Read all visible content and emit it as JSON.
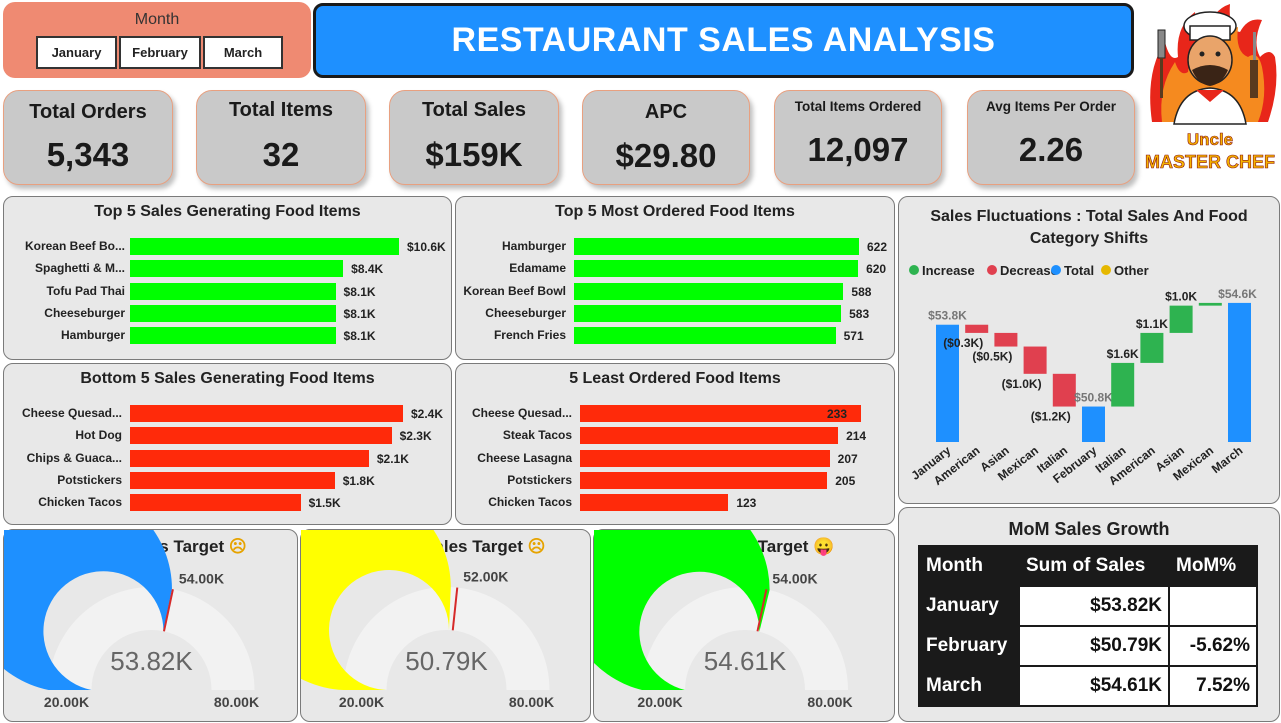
{
  "header": {
    "title": "RESTAURANT SALES ANALYSIS",
    "slicer_title": "Month",
    "months": [
      "January",
      "February",
      "March"
    ]
  },
  "logo": {
    "line1": "Uncle",
    "line2": "MASTER CHEF"
  },
  "kpis": [
    {
      "label": "Total Orders",
      "value": "5,343"
    },
    {
      "label": "Total Items",
      "value": "32"
    },
    {
      "label": "Total Sales",
      "value": "$159K"
    },
    {
      "label": "APC",
      "value": "$29.80"
    },
    {
      "label": "Total Items Ordered",
      "value": "12,097"
    },
    {
      "label": "Avg Items Per Order",
      "value": "2.26"
    }
  ],
  "colors": {
    "green": "#00ff00",
    "red": "#ff2a0a",
    "blue": "#1e90ff",
    "yellow": "#ffff00",
    "dec": "#e0404f",
    "inc": "#2eb350",
    "other": "#e6b800"
  },
  "chart_data": [
    {
      "type": "bar",
      "title": "Top 5 Sales Generating Food Items",
      "categories": [
        "Korean Beef Bo...",
        "Spaghetti & M...",
        "Tofu Pad Thai",
        "Cheeseburger",
        "Hamburger"
      ],
      "values": [
        10.6,
        8.4,
        8.1,
        8.1,
        8.1
      ],
      "labels": [
        "$10.6K",
        "$8.4K",
        "$8.1K",
        "$8.1K",
        "$8.1K"
      ]
    },
    {
      "type": "bar",
      "title": "Top 5 Most Ordered Food Items",
      "categories": [
        "Hamburger",
        "Edamame",
        "Korean Beef Bowl",
        "Cheeseburger",
        "French Fries"
      ],
      "values": [
        622,
        620,
        588,
        583,
        571
      ],
      "labels": [
        "622",
        "620",
        "588",
        "583",
        "571"
      ]
    },
    {
      "type": "bar",
      "title": "Bottom 5 Sales Generating Food Items",
      "categories": [
        "Cheese Quesad...",
        "Hot Dog",
        "Chips & Guaca...",
        "Potstickers",
        "Chicken Tacos"
      ],
      "values": [
        2.4,
        2.3,
        2.1,
        1.8,
        1.5
      ],
      "labels": [
        "$2.4K",
        "$2.3K",
        "$2.1K",
        "$1.8K",
        "$1.5K"
      ]
    },
    {
      "type": "bar",
      "title": "5 Least Ordered Food Items",
      "categories": [
        "Cheese Quesad...",
        "Steak Tacos",
        "Cheese Lasagna",
        "Potstickers",
        "Chicken Tacos"
      ],
      "values": [
        233,
        214,
        207,
        205,
        123
      ],
      "labels": [
        "233",
        "214",
        "207",
        "205",
        "123"
      ]
    },
    {
      "type": "waterfall",
      "title": "Sales Fluctuations : Total Sales And Food Category Shifts",
      "legend": [
        "Increase",
        "Decrease",
        "Total",
        "Other"
      ],
      "categories": [
        "January",
        "American",
        "Asian",
        "Mexican",
        "Italian",
        "February",
        "Italian",
        "American",
        "Asian",
        "Mexican",
        "March"
      ],
      "kinds": [
        "total",
        "dec",
        "dec",
        "dec",
        "dec",
        "total",
        "inc",
        "inc",
        "inc",
        "inc",
        "total"
      ],
      "values": [
        53.8,
        -0.3,
        -0.5,
        -1.0,
        -1.2,
        50.8,
        1.6,
        1.1,
        1.0,
        0.1,
        54.6
      ],
      "labels": [
        "$53.8K",
        "($0.3K)",
        "($0.5K)",
        "($1.0K)",
        "($1.2K)",
        "$50.8K",
        "$1.6K",
        "$1.1K",
        "$1.0K",
        "",
        "$54.6K"
      ],
      "ylim": [
        49.5,
        55
      ]
    },
    {
      "type": "gauge",
      "title": "January Sales Target",
      "value": 53.82,
      "min": 20,
      "max": 80,
      "target": 54,
      "value_label": "53.82K",
      "min_label": "20.00K",
      "max_label": "80.00K",
      "target_label": "54.00K",
      "emoji": "☹"
    },
    {
      "type": "gauge",
      "title": "February Sales Target",
      "value": 50.79,
      "min": 20,
      "max": 80,
      "target": 52,
      "value_label": "50.79K",
      "min_label": "20.00K",
      "max_label": "80.00K",
      "target_label": "52.00K",
      "emoji": "☹"
    },
    {
      "type": "gauge",
      "title": "March Sales Target",
      "value": 54.61,
      "min": 20,
      "max": 80,
      "target": 54,
      "value_label": "54.61K",
      "min_label": "20.00K",
      "max_label": "80.00K",
      "target_label": "54.00K",
      "emoji": "😛"
    },
    {
      "type": "table",
      "title": "MoM Sales Growth",
      "columns": [
        "Month",
        "Sum of Sales",
        "MoM%"
      ],
      "rows": [
        [
          "January",
          "$53.82K",
          ""
        ],
        [
          "February",
          "$50.79K",
          "-5.62%"
        ],
        [
          "March",
          "$54.61K",
          "7.52%"
        ]
      ]
    }
  ]
}
